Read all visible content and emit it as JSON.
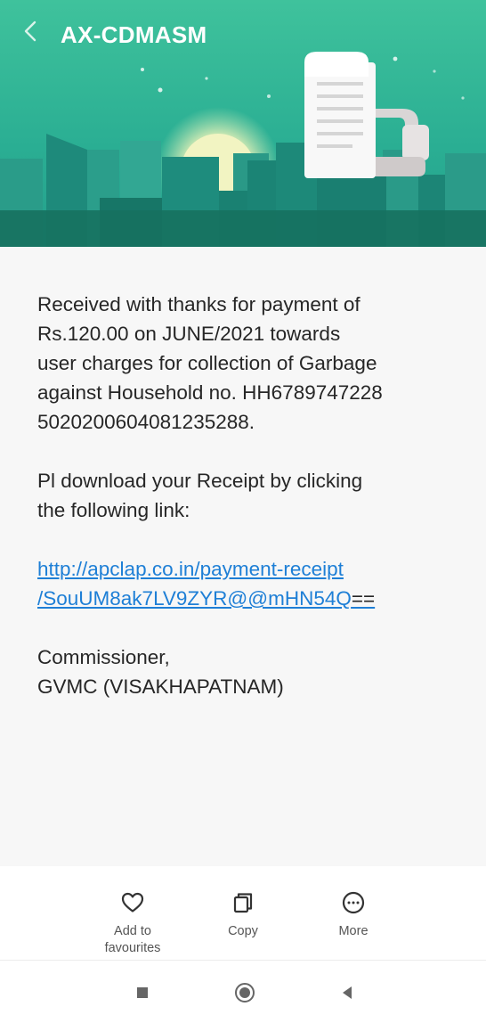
{
  "header": {
    "sender": "AX-CDMASM",
    "back_icon": "chevron-left-icon"
  },
  "message": {
    "paragraph1": [
      "Received with thanks for payment of",
      "Rs.120.00 on JUNE/2021 towards",
      "user charges for collection of Garbage",
      "against Household no. HH6789747228",
      "5020200604081235288."
    ],
    "paragraph2": [
      "Pl download your Receipt by clicking",
      "the following link:"
    ],
    "link": {
      "line1": "http://apclap.co.in/payment-receipt",
      "line2": "/SouUM8ak7LV9ZYR@@mHN54Q",
      "suffix": "=="
    },
    "signature": [
      "Commissioner,",
      "GVMC (VISAKHAPATNAM)"
    ]
  },
  "actions": {
    "favourites": {
      "label_line1": "Add to",
      "label_line2": "favourites",
      "icon": "heart-icon"
    },
    "copy": {
      "label": "Copy",
      "icon": "copy-icon"
    },
    "more": {
      "label": "More",
      "icon": "more-icon"
    }
  },
  "nav": {
    "recents_icon": "square-icon",
    "home_icon": "circle-icon",
    "back_icon": "triangle-back-icon"
  },
  "colors": {
    "banner_top": "#4fd0a7",
    "banner_bottom": "#1f9e8a",
    "link": "#1e7fd6",
    "text": "#262626"
  }
}
